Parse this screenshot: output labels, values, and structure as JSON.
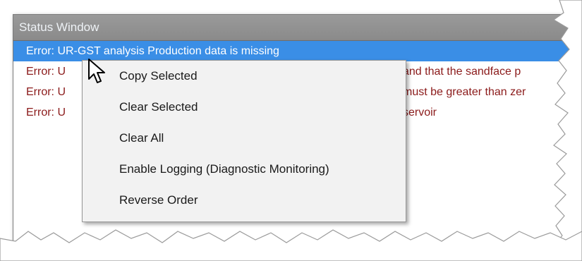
{
  "window": {
    "title": "Status Window"
  },
  "messages": [
    "Error: UR-GST analysis Production data is missing",
    "Error: U",
    "Error: U",
    "Error: U"
  ],
  "messages_tail": [
    "",
    "and that the sandface p",
    "must be greater than zer",
    "servoir"
  ],
  "context_menu": {
    "items": [
      "Copy Selected",
      "Clear Selected",
      "Clear All",
      "Enable Logging (Diagnostic Monitoring)",
      "Reverse Order"
    ]
  },
  "colors": {
    "selection": "#3a8ee6",
    "error_text": "#8b1a1a",
    "titlebar": "#8f8f8f"
  },
  "icons": {
    "cursor": "arrow-pointer-icon"
  }
}
